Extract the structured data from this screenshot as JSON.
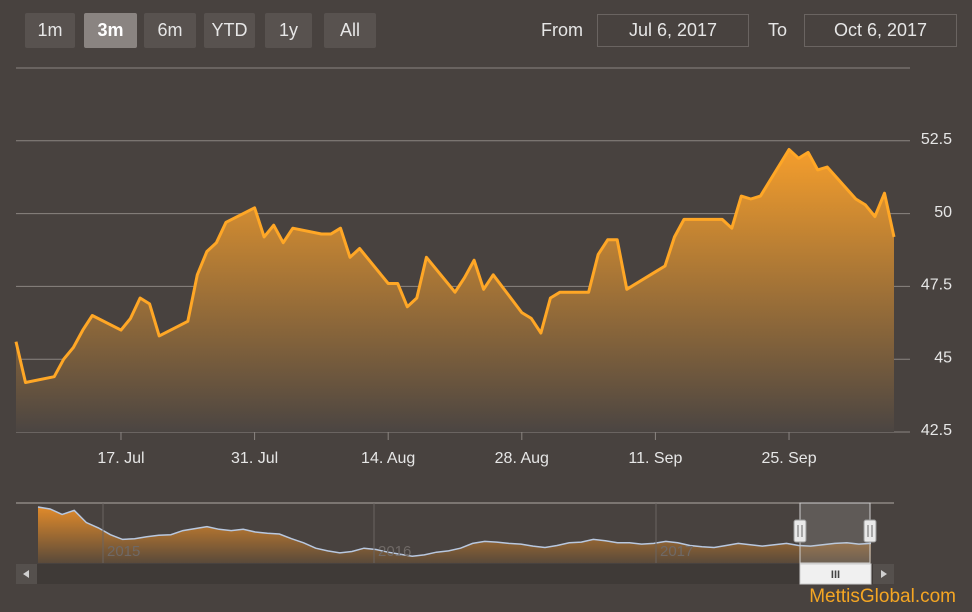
{
  "range_selector": {
    "buttons": [
      {
        "label": "1m",
        "active": false
      },
      {
        "label": "3m",
        "active": true
      },
      {
        "label": "6m",
        "active": false
      },
      {
        "label": "YTD",
        "active": false
      },
      {
        "label": "1y",
        "active": false
      },
      {
        "label": "All",
        "active": false
      }
    ],
    "from_label": "From",
    "from_value": "Jul 6, 2017",
    "to_label": "To",
    "to_value": "Oct 6, 2017"
  },
  "chart_data": {
    "type": "area",
    "x_ticks": [
      "17. Jul",
      "31. Jul",
      "14. Aug",
      "28. Aug",
      "11. Sep",
      "25. Sep"
    ],
    "y_ticks": [
      "42.5",
      "45",
      "47.5",
      "50",
      "52.5"
    ],
    "ylim": [
      42.5,
      55
    ],
    "xlim": [
      "2017-07-06",
      "2017-10-06"
    ],
    "series": [
      {
        "points": [
          [
            "2017-07-06",
            45.6
          ],
          [
            "2017-07-07",
            44.2
          ],
          [
            "2017-07-10",
            44.4
          ],
          [
            "2017-07-11",
            45.0
          ],
          [
            "2017-07-12",
            45.4
          ],
          [
            "2017-07-13",
            46.0
          ],
          [
            "2017-07-14",
            46.5
          ],
          [
            "2017-07-17",
            46.0
          ],
          [
            "2017-07-18",
            46.4
          ],
          [
            "2017-07-19",
            47.1
          ],
          [
            "2017-07-20",
            46.9
          ],
          [
            "2017-07-21",
            45.8
          ],
          [
            "2017-07-24",
            46.3
          ],
          [
            "2017-07-25",
            47.9
          ],
          [
            "2017-07-26",
            48.7
          ],
          [
            "2017-07-27",
            49.0
          ],
          [
            "2017-07-28",
            49.7
          ],
          [
            "2017-07-31",
            50.2
          ],
          [
            "2017-08-01",
            49.2
          ],
          [
            "2017-08-02",
            49.6
          ],
          [
            "2017-08-03",
            49.0
          ],
          [
            "2017-08-04",
            49.5
          ],
          [
            "2017-08-07",
            49.3
          ],
          [
            "2017-08-08",
            49.3
          ],
          [
            "2017-08-09",
            49.5
          ],
          [
            "2017-08-10",
            48.5
          ],
          [
            "2017-08-11",
            48.8
          ],
          [
            "2017-08-14",
            47.6
          ],
          [
            "2017-08-15",
            47.6
          ],
          [
            "2017-08-16",
            46.8
          ],
          [
            "2017-08-17",
            47.1
          ],
          [
            "2017-08-18",
            48.5
          ],
          [
            "2017-08-21",
            47.3
          ],
          [
            "2017-08-22",
            47.8
          ],
          [
            "2017-08-23",
            48.4
          ],
          [
            "2017-08-24",
            47.4
          ],
          [
            "2017-08-25",
            47.9
          ],
          [
            "2017-08-28",
            46.6
          ],
          [
            "2017-08-29",
            46.4
          ],
          [
            "2017-08-30",
            45.9
          ],
          [
            "2017-08-31",
            47.1
          ],
          [
            "2017-09-01",
            47.3
          ],
          [
            "2017-09-04",
            47.3
          ],
          [
            "2017-09-05",
            48.6
          ],
          [
            "2017-09-06",
            49.1
          ],
          [
            "2017-09-07",
            49.1
          ],
          [
            "2017-09-08",
            47.4
          ],
          [
            "2017-09-11",
            48.0
          ],
          [
            "2017-09-12",
            48.2
          ],
          [
            "2017-09-13",
            49.2
          ],
          [
            "2017-09-14",
            49.8
          ],
          [
            "2017-09-15",
            49.8
          ],
          [
            "2017-09-18",
            49.8
          ],
          [
            "2017-09-19",
            49.5
          ],
          [
            "2017-09-20",
            50.6
          ],
          [
            "2017-09-21",
            50.5
          ],
          [
            "2017-09-22",
            50.6
          ],
          [
            "2017-09-25",
            52.2
          ],
          [
            "2017-09-26",
            51.9
          ],
          [
            "2017-09-27",
            52.1
          ],
          [
            "2017-09-28",
            51.5
          ],
          [
            "2017-09-29",
            51.6
          ],
          [
            "2017-10-02",
            50.5
          ],
          [
            "2017-10-03",
            50.3
          ],
          [
            "2017-10-04",
            49.9
          ],
          [
            "2017-10-05",
            50.7
          ],
          [
            "2017-10-06",
            49.2
          ]
        ]
      }
    ],
    "colors": {
      "line": "#ffa726",
      "fill_top": "#f5a030",
      "fill_bottom": "#4b4542",
      "grid": "#8a8481"
    }
  },
  "navigator": {
    "year_labels": [
      "2015",
      "2016",
      "2017"
    ],
    "scroll_grip": "III",
    "handle_grip": "II",
    "overview_series": [
      8.3,
      8.0,
      7.2,
      7.8,
      6.0,
      5.2,
      4.2,
      3.5,
      3.6,
      3.9,
      4.1,
      4.2,
      4.8,
      5.1,
      5.4,
      5.0,
      4.8,
      5.0,
      4.6,
      4.4,
      4.3,
      3.6,
      3.0,
      2.2,
      1.8,
      1.5,
      1.7,
      2.2,
      2.0,
      1.6,
      1.3,
      1.0,
      1.2,
      1.6,
      1.8,
      2.2,
      2.9,
      3.2,
      3.1,
      2.9,
      2.8,
      2.5,
      2.3,
      2.6,
      3.0,
      3.1,
      3.5,
      3.3,
      3.0,
      3.0,
      2.8,
      2.9,
      3.2,
      3.0,
      2.6,
      2.4,
      2.3,
      2.6,
      2.9,
      2.7,
      2.5,
      2.7,
      2.9,
      2.6,
      2.5,
      2.7,
      2.9,
      3.0,
      2.8,
      2.9
    ],
    "selection_start": 0.9257,
    "selection_end": 1.0
  },
  "watermark": "MettisGlobal.com"
}
